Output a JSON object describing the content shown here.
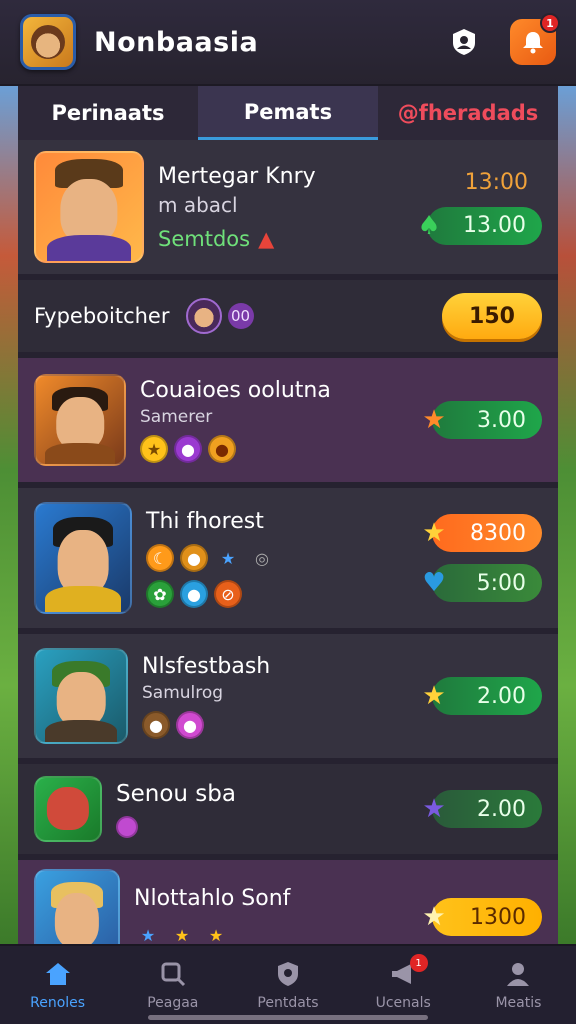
{
  "header": {
    "title": "Nonbaasia",
    "notification_count": "1"
  },
  "tabs": [
    {
      "label": "Perinaats",
      "active": false
    },
    {
      "label": "Pemats",
      "active": true
    },
    {
      "label": "@fheradads",
      "active": false,
      "alert": true
    }
  ],
  "list": [
    {
      "name": "Mertegar Knry",
      "subtitle": "m abacl",
      "tag": "Semtdos",
      "price_top": "13:00",
      "price": "13.00",
      "price_color": "green"
    },
    {
      "name": "Fypeboitcher",
      "badge": "00",
      "button": "150"
    },
    {
      "name": "Couaioes oolutna",
      "subtitle": "Samerer",
      "price": "3.00",
      "price_color": "green"
    },
    {
      "name": "Thi fhorest",
      "price_top": "8300",
      "price": "5:00",
      "price_color": "green"
    },
    {
      "name": "Nlsfestbash",
      "subtitle": "Samulrog",
      "price": "2.00",
      "price_color": "green"
    },
    {
      "name": "Senou sba",
      "price": "2.00",
      "price_color": "green"
    },
    {
      "name": "Nlottahlo Sonf",
      "price": "1300",
      "price_color": "yellow"
    }
  ],
  "bottom_nav": [
    {
      "label": "Renoles",
      "icon": "home-icon",
      "active": true
    },
    {
      "label": "Peagaa",
      "icon": "search-icon",
      "active": false
    },
    {
      "label": "Pentdats",
      "icon": "shield-icon",
      "active": false
    },
    {
      "label": "Ucenals",
      "icon": "megaphone-icon",
      "active": false,
      "badge": "1"
    },
    {
      "label": "Meatis",
      "icon": "profile-icon",
      "active": false
    }
  ],
  "colors": {
    "accent": "#3a9bdc",
    "price_green": "#1fa64a",
    "price_orange": "#ff7a22",
    "price_yellow": "#ffc21a",
    "alert_red": "#ef4c5c"
  }
}
